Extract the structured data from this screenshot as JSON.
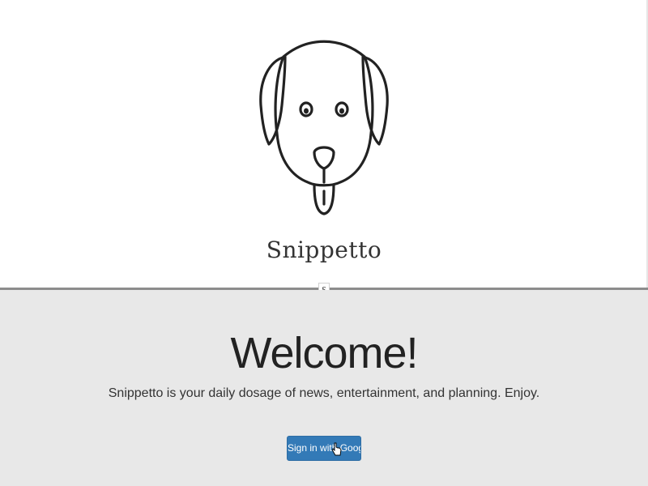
{
  "app": {
    "brand_name": "Snippetto",
    "logo_icon": "dog-face-icon",
    "section_mark": "§"
  },
  "welcome": {
    "heading": "Welcome!",
    "tagline": "Snippetto is your daily dosage of news, entertainment, and planning. Enjoy.",
    "signin_label": "Sign in with Google"
  },
  "colors": {
    "button_bg": "#337ab7",
    "lower_bg": "#e8e8e8",
    "divider": "#8c8c8c"
  }
}
